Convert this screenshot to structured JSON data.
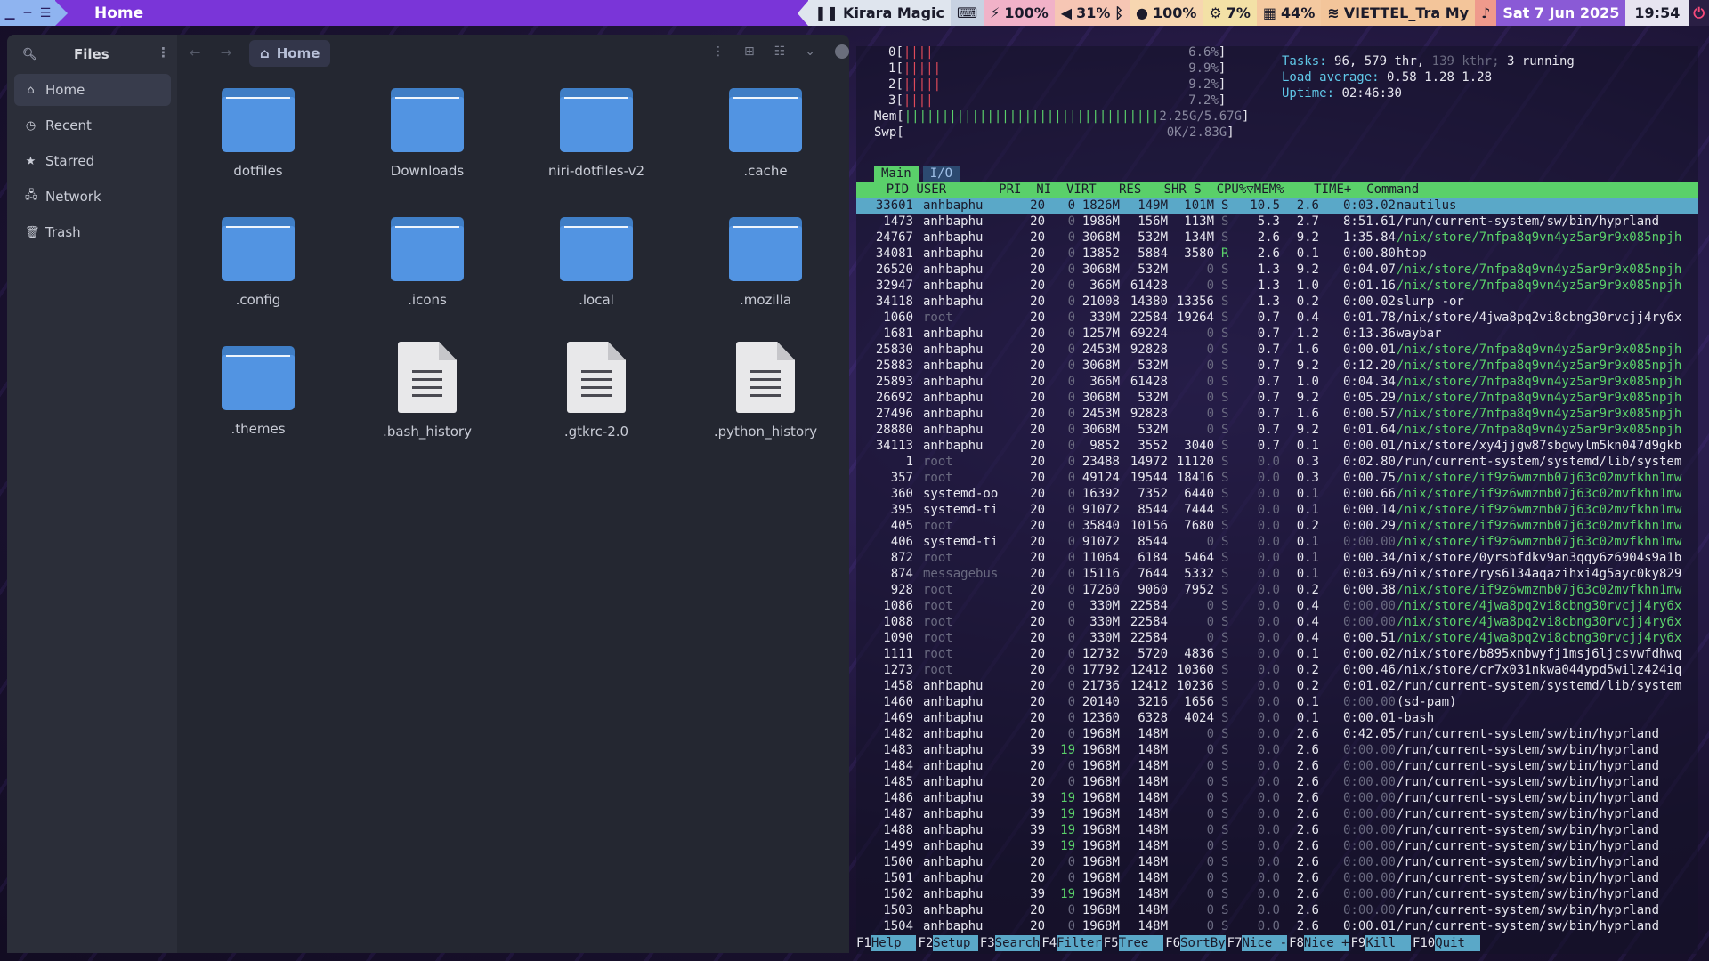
{
  "topbar": {
    "active_title": "Home",
    "music": "Kirara Magic",
    "battery": "100%",
    "volume": "31%",
    "brightness": "100%",
    "cpu": "7%",
    "memory": "44%",
    "wifi": "VIETTEL_Tra My",
    "date": "Sat  7 Jun 2025",
    "time": "19:54"
  },
  "files": {
    "sidebar_title": "Files",
    "breadcrumb": "Home",
    "sidebar_items": [
      {
        "label": "Home",
        "icon": "home-icon"
      },
      {
        "label": "Recent",
        "icon": "clock-icon"
      },
      {
        "label": "Starred",
        "icon": "star-icon"
      },
      {
        "label": "Network",
        "icon": "network-icon"
      },
      {
        "label": "Trash",
        "icon": "trash-icon"
      }
    ],
    "items": [
      {
        "name": "dotfiles",
        "kind": "folder"
      },
      {
        "name": "Downloads",
        "kind": "folder"
      },
      {
        "name": "niri-dotfiles-v2",
        "kind": "folder"
      },
      {
        "name": ".cache",
        "kind": "folder"
      },
      {
        "name": ".config",
        "kind": "folder"
      },
      {
        "name": ".icons",
        "kind": "folder"
      },
      {
        "name": ".local",
        "kind": "folder"
      },
      {
        "name": ".mozilla",
        "kind": "folder"
      },
      {
        "name": ".themes",
        "kind": "folder"
      },
      {
        "name": ".bash_history",
        "kind": "file"
      },
      {
        "name": ".gtkrc-2.0",
        "kind": "file"
      },
      {
        "name": ".python_history",
        "kind": "file"
      }
    ]
  },
  "htop": {
    "cpus": [
      {
        "label": "0",
        "bars": "||||",
        "value": "6.6%"
      },
      {
        "label": "1",
        "bars": "|||||",
        "value": "9.9%"
      },
      {
        "label": "2",
        "bars": "|||||",
        "value": "9.2%"
      },
      {
        "label": "3",
        "bars": "||||",
        "value": "7.2%"
      }
    ],
    "mem": {
      "label": "Mem",
      "bars": "||||||||||||||||||||||||||||||||||",
      "value": "2.25G/5.67G"
    },
    "swp": {
      "label": "Swp",
      "value": "0K/2.83G"
    },
    "tasks_label": "Tasks:",
    "tasks": "96,",
    "threads": "579",
    "thr_label": "thr,",
    "kthr": "139 kthr;",
    "running": "3",
    "running_label": "running",
    "load_label": "Load average:",
    "load": "0.58 1.28 1.28",
    "uptime_label": "Uptime:",
    "uptime": "02:46:30",
    "tab_main": "Main",
    "tab_io": "I/O",
    "columns": "    PID USER       PRI  NI  VIRT   RES   SHR S  CPU%▽MEM%    TIME+  Command",
    "processes": [
      [
        "33601",
        "anhbaphu",
        "20",
        "0",
        "1826M",
        "149M",
        "101M",
        "S",
        "10.5",
        "2.6",
        "0:03.02",
        "nautilus"
      ],
      [
        "1473",
        "anhbaphu",
        "20",
        "0",
        "1986M",
        "156M",
        "113M",
        "S",
        "5.3",
        "2.7",
        "8:51.61",
        "/run/current-system/sw/bin/hyprland"
      ],
      [
        "24767",
        "anhbaphu",
        "20",
        "0",
        "3068M",
        "532M",
        "134M",
        "S",
        "2.6",
        "9.2",
        "1:35.84",
        "/nix/store/7nfpa8q9vn4yz5ar9r9x085npjh"
      ],
      [
        "34081",
        "anhbaphu",
        "20",
        "0",
        "13852",
        "5884",
        "3580",
        "R",
        "2.6",
        "0.1",
        "0:00.80",
        "htop"
      ],
      [
        "26520",
        "anhbaphu",
        "20",
        "0",
        "3068M",
        "532M",
        "0",
        "S",
        "1.3",
        "9.2",
        "0:04.07",
        "/nix/store/7nfpa8q9vn4yz5ar9r9x085npjh"
      ],
      [
        "32947",
        "anhbaphu",
        "20",
        "0",
        "366M",
        "61428",
        "0",
        "S",
        "1.3",
        "1.0",
        "0:01.16",
        "/nix/store/7nfpa8q9vn4yz5ar9r9x085npjh"
      ],
      [
        "34118",
        "anhbaphu",
        "20",
        "0",
        "21008",
        "14380",
        "13356",
        "S",
        "1.3",
        "0.2",
        "0:00.02",
        "slurp -or"
      ],
      [
        "1060",
        "root",
        "20",
        "0",
        "330M",
        "22584",
        "19264",
        "S",
        "0.7",
        "0.4",
        "0:01.78",
        "/nix/store/4jwa8pq2vi8cbng30rvcjj4ry6x"
      ],
      [
        "1681",
        "anhbaphu",
        "20",
        "0",
        "1257M",
        "69224",
        "0",
        "S",
        "0.7",
        "1.2",
        "0:13.36",
        "waybar"
      ],
      [
        "25830",
        "anhbaphu",
        "20",
        "0",
        "2453M",
        "92828",
        "0",
        "S",
        "0.7",
        "1.6",
        "0:00.01",
        "/nix/store/7nfpa8q9vn4yz5ar9r9x085npjh"
      ],
      [
        "25883",
        "anhbaphu",
        "20",
        "0",
        "3068M",
        "532M",
        "0",
        "S",
        "0.7",
        "9.2",
        "0:12.20",
        "/nix/store/7nfpa8q9vn4yz5ar9r9x085npjh"
      ],
      [
        "25893",
        "anhbaphu",
        "20",
        "0",
        "366M",
        "61428",
        "0",
        "S",
        "0.7",
        "1.0",
        "0:04.34",
        "/nix/store/7nfpa8q9vn4yz5ar9r9x085npjh"
      ],
      [
        "26692",
        "anhbaphu",
        "20",
        "0",
        "3068M",
        "532M",
        "0",
        "S",
        "0.7",
        "9.2",
        "0:05.29",
        "/nix/store/7nfpa8q9vn4yz5ar9r9x085npjh"
      ],
      [
        "27496",
        "anhbaphu",
        "20",
        "0",
        "2453M",
        "92828",
        "0",
        "S",
        "0.7",
        "1.6",
        "0:00.57",
        "/nix/store/7nfpa8q9vn4yz5ar9r9x085npjh"
      ],
      [
        "28880",
        "anhbaphu",
        "20",
        "0",
        "3068M",
        "532M",
        "0",
        "S",
        "0.7",
        "9.2",
        "0:01.64",
        "/nix/store/7nfpa8q9vn4yz5ar9r9x085npjh"
      ],
      [
        "34113",
        "anhbaphu",
        "20",
        "0",
        "9852",
        "3552",
        "3040",
        "S",
        "0.7",
        "0.1",
        "0:00.01",
        "/nix/store/xy4jjgw87sbgwylm5kn047d9gkb"
      ],
      [
        "1",
        "root",
        "20",
        "0",
        "23488",
        "14972",
        "11120",
        "S",
        "0.0",
        "0.3",
        "0:02.80",
        "/run/current-system/systemd/lib/system"
      ],
      [
        "357",
        "root",
        "20",
        "0",
        "49124",
        "19544",
        "18416",
        "S",
        "0.0",
        "0.3",
        "0:00.75",
        "/nix/store/if9z6wmzmb07j63c02mvfkhn1mw"
      ],
      [
        "360",
        "systemd-oo",
        "20",
        "0",
        "16392",
        "7352",
        "6440",
        "S",
        "0.0",
        "0.1",
        "0:00.66",
        "/nix/store/if9z6wmzmb07j63c02mvfkhn1mw"
      ],
      [
        "395",
        "systemd-ti",
        "20",
        "0",
        "91072",
        "8544",
        "7444",
        "S",
        "0.0",
        "0.1",
        "0:00.14",
        "/nix/store/if9z6wmzmb07j63c02mvfkhn1mw"
      ],
      [
        "405",
        "root",
        "20",
        "0",
        "35840",
        "10156",
        "7680",
        "S",
        "0.0",
        "0.2",
        "0:00.29",
        "/nix/store/if9z6wmzmb07j63c02mvfkhn1mw"
      ],
      [
        "406",
        "systemd-ti",
        "20",
        "0",
        "91072",
        "8544",
        "0",
        "S",
        "0.0",
        "0.1",
        "0:00.00",
        "/nix/store/if9z6wmzmb07j63c02mvfkhn1mw"
      ],
      [
        "872",
        "root",
        "20",
        "0",
        "11064",
        "6184",
        "5464",
        "S",
        "0.0",
        "0.1",
        "0:00.34",
        "/nix/store/0yrsbfdkv9an3qqy6z6904s9a1b"
      ],
      [
        "874",
        "messagebus",
        "20",
        "0",
        "15116",
        "7644",
        "5332",
        "S",
        "0.0",
        "0.1",
        "0:03.69",
        "/nix/store/rys6134aqazihxi4g5ayc0ky829"
      ],
      [
        "928",
        "root",
        "20",
        "0",
        "17260",
        "9060",
        "7952",
        "S",
        "0.0",
        "0.2",
        "0:00.38",
        "/nix/store/if9z6wmzmb07j63c02mvfkhn1mw"
      ],
      [
        "1086",
        "root",
        "20",
        "0",
        "330M",
        "22584",
        "0",
        "S",
        "0.0",
        "0.4",
        "0:00.00",
        "/nix/store/4jwa8pq2vi8cbng30rvcjj4ry6x"
      ],
      [
        "1088",
        "root",
        "20",
        "0",
        "330M",
        "22584",
        "0",
        "S",
        "0.0",
        "0.4",
        "0:00.00",
        "/nix/store/4jwa8pq2vi8cbng30rvcjj4ry6x"
      ],
      [
        "1090",
        "root",
        "20",
        "0",
        "330M",
        "22584",
        "0",
        "S",
        "0.0",
        "0.4",
        "0:00.51",
        "/nix/store/4jwa8pq2vi8cbng30rvcjj4ry6x"
      ],
      [
        "1111",
        "root",
        "20",
        "0",
        "12732",
        "5720",
        "4836",
        "S",
        "0.0",
        "0.1",
        "0:00.02",
        "/nix/store/b895xnbwyfj1msj6ljcsvwfdhwq"
      ],
      [
        "1273",
        "root",
        "20",
        "0",
        "17792",
        "12412",
        "10360",
        "S",
        "0.0",
        "0.2",
        "0:00.46",
        "/nix/store/cr7x031nkwa044ypd5wilz424iq"
      ],
      [
        "1458",
        "anhbaphu",
        "20",
        "0",
        "21736",
        "12412",
        "10236",
        "S",
        "0.0",
        "0.2",
        "0:01.02",
        "/run/current-system/systemd/lib/system"
      ],
      [
        "1460",
        "anhbaphu",
        "20",
        "0",
        "20140",
        "3216",
        "1656",
        "S",
        "0.0",
        "0.1",
        "0:00.00",
        "(sd-pam)"
      ],
      [
        "1469",
        "anhbaphu",
        "20",
        "0",
        "12360",
        "6328",
        "4024",
        "S",
        "0.0",
        "0.1",
        "0:00.01",
        "-bash"
      ],
      [
        "1482",
        "anhbaphu",
        "20",
        "0",
        "1968M",
        "148M",
        "0",
        "S",
        "0.0",
        "2.6",
        "0:42.05",
        "/run/current-system/sw/bin/hyprland"
      ],
      [
        "1483",
        "anhbaphu",
        "39",
        "19",
        "1968M",
        "148M",
        "0",
        "S",
        "0.0",
        "2.6",
        "0:00.00",
        "/run/current-system/sw/bin/hyprland"
      ],
      [
        "1484",
        "anhbaphu",
        "20",
        "0",
        "1968M",
        "148M",
        "0",
        "S",
        "0.0",
        "2.6",
        "0:00.00",
        "/run/current-system/sw/bin/hyprland"
      ],
      [
        "1485",
        "anhbaphu",
        "20",
        "0",
        "1968M",
        "148M",
        "0",
        "S",
        "0.0",
        "2.6",
        "0:00.00",
        "/run/current-system/sw/bin/hyprland"
      ],
      [
        "1486",
        "anhbaphu",
        "39",
        "19",
        "1968M",
        "148M",
        "0",
        "S",
        "0.0",
        "2.6",
        "0:00.00",
        "/run/current-system/sw/bin/hyprland"
      ],
      [
        "1487",
        "anhbaphu",
        "39",
        "19",
        "1968M",
        "148M",
        "0",
        "S",
        "0.0",
        "2.6",
        "0:00.00",
        "/run/current-system/sw/bin/hyprland"
      ],
      [
        "1488",
        "anhbaphu",
        "39",
        "19",
        "1968M",
        "148M",
        "0",
        "S",
        "0.0",
        "2.6",
        "0:00.00",
        "/run/current-system/sw/bin/hyprland"
      ],
      [
        "1499",
        "anhbaphu",
        "39",
        "19",
        "1968M",
        "148M",
        "0",
        "S",
        "0.0",
        "2.6",
        "0:00.00",
        "/run/current-system/sw/bin/hyprland"
      ],
      [
        "1500",
        "anhbaphu",
        "20",
        "0",
        "1968M",
        "148M",
        "0",
        "S",
        "0.0",
        "2.6",
        "0:00.00",
        "/run/current-system/sw/bin/hyprland"
      ],
      [
        "1501",
        "anhbaphu",
        "20",
        "0",
        "1968M",
        "148M",
        "0",
        "S",
        "0.0",
        "2.6",
        "0:00.00",
        "/run/current-system/sw/bin/hyprland"
      ],
      [
        "1502",
        "anhbaphu",
        "39",
        "19",
        "1968M",
        "148M",
        "0",
        "S",
        "0.0",
        "2.6",
        "0:00.00",
        "/run/current-system/sw/bin/hyprland"
      ],
      [
        "1503",
        "anhbaphu",
        "20",
        "0",
        "1968M",
        "148M",
        "0",
        "S",
        "0.0",
        "2.6",
        "0:00.00",
        "/run/current-system/sw/bin/hyprland"
      ],
      [
        "1504",
        "anhbaphu",
        "20",
        "0",
        "1968M",
        "148M",
        "0",
        "S",
        "0.0",
        "2.6",
        "0:00.01",
        "/run/current-system/sw/bin/hyprland"
      ]
    ],
    "fkeys": [
      {
        "key": "F1",
        "label": "Help  "
      },
      {
        "key": "F2",
        "label": "Setup "
      },
      {
        "key": "F3",
        "label": "Search"
      },
      {
        "key": "F4",
        "label": "Filter"
      },
      {
        "key": "F5",
        "label": "Tree  "
      },
      {
        "key": "F6",
        "label": "SortBy"
      },
      {
        "key": "F7",
        "label": "Nice -"
      },
      {
        "key": "F8",
        "label": "Nice +"
      },
      {
        "key": "F9",
        "label": "Kill  "
      },
      {
        "key": "F10",
        "label": "Quit  "
      }
    ]
  }
}
